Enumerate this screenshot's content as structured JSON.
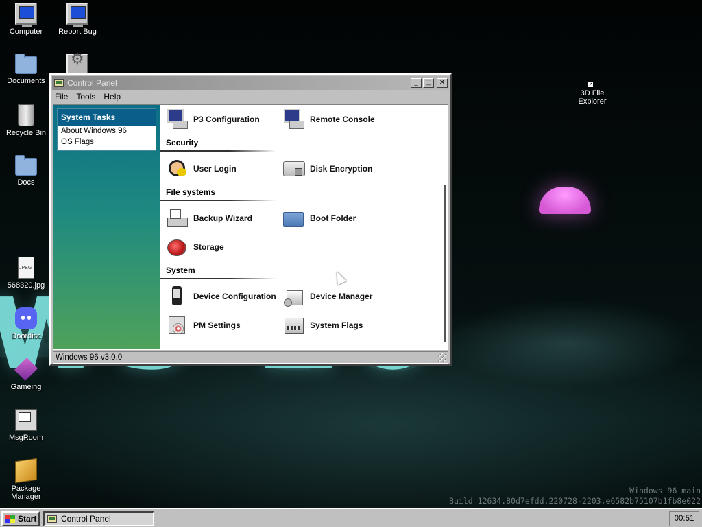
{
  "desktop": {
    "icons": [
      {
        "label": "Computer",
        "icon": "computer-icon"
      },
      {
        "label": "Report Bug",
        "icon": "report-bug-icon"
      },
      {
        "label": "Documents",
        "icon": "folder-icon"
      },
      {
        "label": "Recycle Bin",
        "icon": "recycle-bin-icon"
      },
      {
        "label": "Docs",
        "icon": "folder-icon"
      },
      {
        "label": "568320.jpg",
        "icon": "jpeg-file-icon"
      },
      {
        "label": "Doordisc",
        "icon": "discord-icon"
      },
      {
        "label": "Gameing",
        "icon": "game-cube-icon"
      },
      {
        "label": "MsgRoom",
        "icon": "msgroom-icon"
      },
      {
        "label": "Package Manager",
        "icon": "package-icon"
      },
      {
        "label": "3D File Explorer",
        "icon": "shortcut-icon"
      }
    ],
    "wallpaper_text": "ws 10",
    "build_line1": "Windows 96 main",
    "build_line2": "Build 12634.80d7efdd.220728-2203.e6582b75107b1fb8e022"
  },
  "window": {
    "title": "Control Panel",
    "buttons": {
      "minimize": "_",
      "maximize": "□",
      "close": "✕"
    },
    "menu": [
      "File",
      "Tools",
      "Help"
    ],
    "sidebar": {
      "header": "System Tasks",
      "links": [
        "About Windows 96",
        "OS Flags"
      ]
    },
    "sections": {
      "security": "Security",
      "file_systems": "File systems",
      "system": "System"
    },
    "items": {
      "p3": "P3 Configuration",
      "remote": "Remote Console",
      "login": "User Login",
      "encryption": "Disk Encryption",
      "backup": "Backup Wizard",
      "boot": "Boot Folder",
      "storage": "Storage",
      "devconf": "Device Configuration",
      "devmgr": "Device Manager",
      "pm": "PM Settings",
      "flags": "System Flags"
    },
    "status": "Windows 96 v3.0.0"
  },
  "taskbar": {
    "start": "Start",
    "task": "Control Panel",
    "clock": "00:51"
  }
}
